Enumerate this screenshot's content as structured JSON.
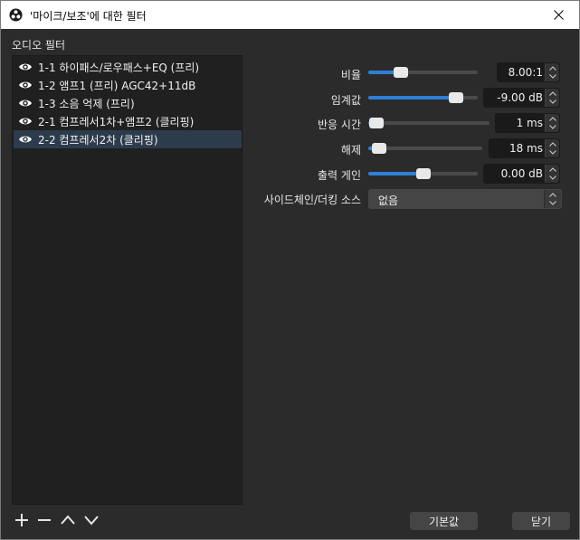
{
  "window": {
    "title": "'마이크/보조'에 대한 필터",
    "app_icon": "obs-logo-icon",
    "close_icon": "close-icon"
  },
  "left_panel": {
    "section_label": "오디오 필터",
    "filters": [
      {
        "name": "1-1 하이패스/로우패스+EQ (프리)",
        "visible": true,
        "selected": false
      },
      {
        "name": "1-2 앰프1 (프리) AGC42+11dB",
        "visible": true,
        "selected": false
      },
      {
        "name": "1-3 소음 억제 (프리)",
        "visible": true,
        "selected": false
      },
      {
        "name": "2-1 컴프레서1차+앰프2 (클리핑)",
        "visible": true,
        "selected": false
      },
      {
        "name": "2-2 컴프레서2차 (클리핑)",
        "visible": true,
        "selected": true
      }
    ],
    "toolbar": {
      "add_icon": "plus-icon",
      "remove_icon": "minus-icon",
      "move_up_icon": "chevron-up-icon",
      "move_down_icon": "chevron-down-icon"
    }
  },
  "properties": {
    "ratio": {
      "label": "비율",
      "value": "8.00:1",
      "fill_fraction": 0.3
    },
    "threshold": {
      "label": "임계값",
      "value": "-9.00 dB",
      "fill_fraction": 0.8
    },
    "attack": {
      "label": "반응 시간",
      "value": "1 ms",
      "fill_fraction": 0.02
    },
    "release": {
      "label": "해제",
      "value": "18 ms",
      "fill_fraction": 0.05
    },
    "output_gain": {
      "label": "출력 게인",
      "value": "0.00 dB",
      "fill_fraction": 0.5
    },
    "sidechain": {
      "label": "사이드체인/더킹 소스",
      "value": "없음"
    }
  },
  "buttons": {
    "defaults": "기본값",
    "close": "닫기"
  },
  "colors": {
    "accent": "#2f7fd8",
    "selected_row": "#2d3c4d",
    "background": "#2b2b2b",
    "list_background": "#202020"
  }
}
